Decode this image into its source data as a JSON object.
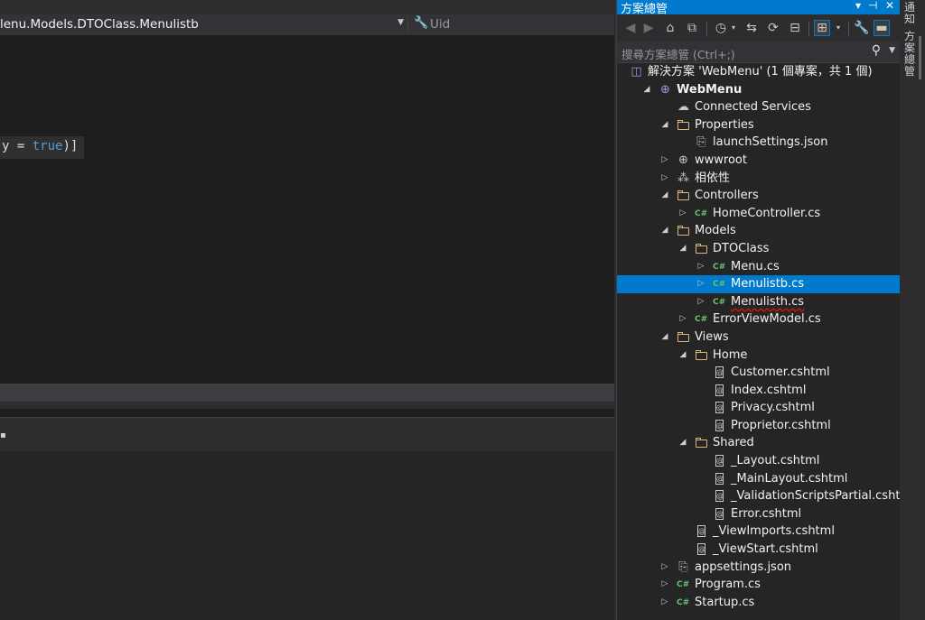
{
  "editor": {
    "nav_path": "lenu.Models.DTOClass.Menulistb",
    "nav_member": "Uid",
    "code_text": "y = ",
    "code_keyword": "true",
    "code_tail": ")]"
  },
  "solution_explorer": {
    "title": "方案總管",
    "search_placeholder": "搜尋方案總管 (Ctrl+;)",
    "tree": [
      {
        "label": "解決方案 'WebMenu' (1 個專案，共 1 個)",
        "depth": 0,
        "expand": "",
        "icon": "solution-icon"
      },
      {
        "label": "WebMenu",
        "depth": 0,
        "expand": "open",
        "icon": "web-project-icon",
        "bold": true
      },
      {
        "label": "Connected Services",
        "depth": 1,
        "expand": "",
        "icon": "cloud-icon"
      },
      {
        "label": "Properties",
        "depth": 1,
        "expand": "open",
        "icon": "properties-folder-icon"
      },
      {
        "label": "launchSettings.json",
        "depth": 2,
        "expand": "",
        "icon": "json-icon"
      },
      {
        "label": "wwwroot",
        "depth": 1,
        "expand": "closed",
        "icon": "globe-icon"
      },
      {
        "label": "相依性",
        "depth": 1,
        "expand": "closed",
        "icon": "dependencies-icon"
      },
      {
        "label": "Controllers",
        "depth": 1,
        "expand": "open",
        "icon": "folder-icon"
      },
      {
        "label": "HomeController.cs",
        "depth": 2,
        "expand": "closed",
        "icon": "csharp-icon"
      },
      {
        "label": "Models",
        "depth": 1,
        "expand": "open",
        "icon": "folder-icon"
      },
      {
        "label": "DTOClass",
        "depth": 2,
        "expand": "open",
        "icon": "folder-icon"
      },
      {
        "label": "Menu.cs",
        "depth": 3,
        "expand": "closed",
        "icon": "csharp-icon"
      },
      {
        "label": "Menulistb.cs",
        "depth": 3,
        "expand": "closed",
        "icon": "csharp-icon",
        "selected": true
      },
      {
        "label": "Menulisth.cs",
        "depth": 3,
        "expand": "closed",
        "icon": "csharp-icon",
        "error": true
      },
      {
        "label": "ErrorViewModel.cs",
        "depth": 2,
        "expand": "closed",
        "icon": "csharp-icon"
      },
      {
        "label": "Views",
        "depth": 1,
        "expand": "open",
        "icon": "folder-icon"
      },
      {
        "label": "Home",
        "depth": 2,
        "expand": "open",
        "icon": "folder-icon"
      },
      {
        "label": "Customer.cshtml",
        "depth": 3,
        "expand": "",
        "icon": "razor-icon"
      },
      {
        "label": "Index.cshtml",
        "depth": 3,
        "expand": "",
        "icon": "razor-icon"
      },
      {
        "label": "Privacy.cshtml",
        "depth": 3,
        "expand": "",
        "icon": "razor-icon"
      },
      {
        "label": "Proprietor.cshtml",
        "depth": 3,
        "expand": "",
        "icon": "razor-icon"
      },
      {
        "label": "Shared",
        "depth": 2,
        "expand": "open",
        "icon": "folder-icon"
      },
      {
        "label": "_Layout.cshtml",
        "depth": 3,
        "expand": "",
        "icon": "razor-icon"
      },
      {
        "label": "_MainLayout.cshtml",
        "depth": 3,
        "expand": "",
        "icon": "razor-icon"
      },
      {
        "label": "_ValidationScriptsPartial.cshtml",
        "depth": 3,
        "expand": "",
        "icon": "razor-icon"
      },
      {
        "label": "Error.cshtml",
        "depth": 3,
        "expand": "",
        "icon": "razor-icon"
      },
      {
        "label": "_ViewImports.cshtml",
        "depth": 2,
        "expand": "",
        "icon": "razor-icon"
      },
      {
        "label": "_ViewStart.cshtml",
        "depth": 2,
        "expand": "",
        "icon": "razor-icon"
      },
      {
        "label": "appsettings.json",
        "depth": 1,
        "expand": "closed",
        "icon": "json-icon"
      },
      {
        "label": "Program.cs",
        "depth": 1,
        "expand": "closed",
        "icon": "csharp-icon"
      },
      {
        "label": "Startup.cs",
        "depth": 1,
        "expand": "closed",
        "icon": "csharp-icon"
      }
    ]
  },
  "side_tabs": {
    "notifications": "通知",
    "solution_explorer": "方案總管"
  },
  "colors": {
    "accent": "#007acc",
    "csharp": "#68c26d",
    "folder": "#dcb67a",
    "error_squiggle": "#e51400"
  }
}
